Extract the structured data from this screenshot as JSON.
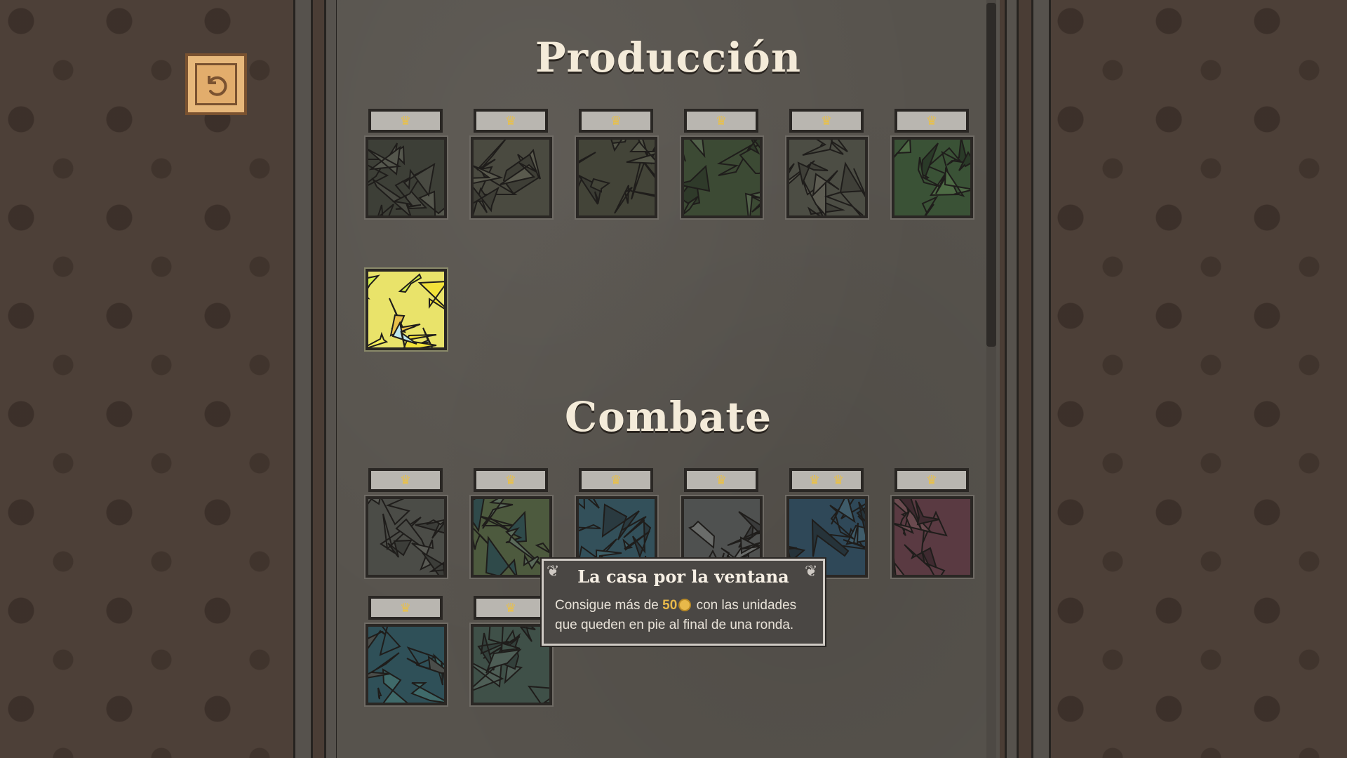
{
  "sections": {
    "production": {
      "title": "Producción"
    },
    "combat": {
      "title": "Combate"
    }
  },
  "icons": {
    "back": "undo-arrow-icon",
    "crown": "crown-icon",
    "coin": "coin-icon"
  },
  "crown_glyph": "♛",
  "production_achievements": [
    {
      "crowns": 1,
      "unlocked": false
    },
    {
      "crowns": 1,
      "unlocked": false
    },
    {
      "crowns": 1,
      "unlocked": false
    },
    {
      "crowns": 1,
      "unlocked": false
    },
    {
      "crowns": 1,
      "unlocked": false
    },
    {
      "crowns": 1,
      "unlocked": false
    },
    {
      "crowns": 0,
      "unlocked": true
    }
  ],
  "combat_achievements": [
    {
      "crowns": 1,
      "unlocked": false
    },
    {
      "crowns": 1,
      "unlocked": false
    },
    {
      "crowns": 1,
      "unlocked": false
    },
    {
      "crowns": 1,
      "unlocked": false
    },
    {
      "crowns": 2,
      "unlocked": false
    },
    {
      "crowns": 1,
      "unlocked": false
    },
    {
      "crowns": 1,
      "unlocked": false
    },
    {
      "crowns": 1,
      "unlocked": false
    }
  ],
  "tooltip": {
    "title": "La casa por la ventana",
    "body_prefix": "Consigue más de ",
    "amount": "50",
    "body_suffix": " con las unidades que queden en pie al final de una ronda."
  },
  "colors": {
    "crown": "#e8c04a",
    "coin": "#e8b94a",
    "title": "#f4ebd9"
  }
}
